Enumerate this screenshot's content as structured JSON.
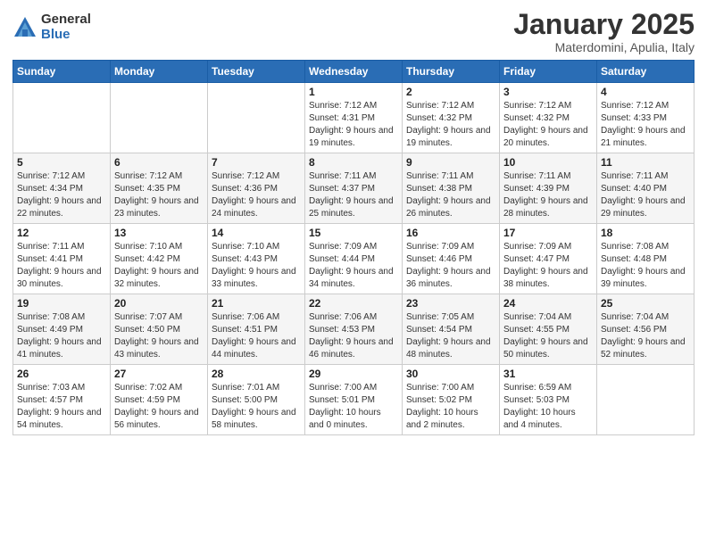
{
  "header": {
    "logo_general": "General",
    "logo_blue": "Blue",
    "month_title": "January 2025",
    "subtitle": "Materdomini, Apulia, Italy"
  },
  "days_of_week": [
    "Sunday",
    "Monday",
    "Tuesday",
    "Wednesday",
    "Thursday",
    "Friday",
    "Saturday"
  ],
  "weeks": [
    [
      {
        "day": "",
        "sunrise": "",
        "sunset": "",
        "daylight": ""
      },
      {
        "day": "",
        "sunrise": "",
        "sunset": "",
        "daylight": ""
      },
      {
        "day": "",
        "sunrise": "",
        "sunset": "",
        "daylight": ""
      },
      {
        "day": "1",
        "sunrise": "Sunrise: 7:12 AM",
        "sunset": "Sunset: 4:31 PM",
        "daylight": "Daylight: 9 hours and 19 minutes."
      },
      {
        "day": "2",
        "sunrise": "Sunrise: 7:12 AM",
        "sunset": "Sunset: 4:32 PM",
        "daylight": "Daylight: 9 hours and 19 minutes."
      },
      {
        "day": "3",
        "sunrise": "Sunrise: 7:12 AM",
        "sunset": "Sunset: 4:32 PM",
        "daylight": "Daylight: 9 hours and 20 minutes."
      },
      {
        "day": "4",
        "sunrise": "Sunrise: 7:12 AM",
        "sunset": "Sunset: 4:33 PM",
        "daylight": "Daylight: 9 hours and 21 minutes."
      }
    ],
    [
      {
        "day": "5",
        "sunrise": "Sunrise: 7:12 AM",
        "sunset": "Sunset: 4:34 PM",
        "daylight": "Daylight: 9 hours and 22 minutes."
      },
      {
        "day": "6",
        "sunrise": "Sunrise: 7:12 AM",
        "sunset": "Sunset: 4:35 PM",
        "daylight": "Daylight: 9 hours and 23 minutes."
      },
      {
        "day": "7",
        "sunrise": "Sunrise: 7:12 AM",
        "sunset": "Sunset: 4:36 PM",
        "daylight": "Daylight: 9 hours and 24 minutes."
      },
      {
        "day": "8",
        "sunrise": "Sunrise: 7:11 AM",
        "sunset": "Sunset: 4:37 PM",
        "daylight": "Daylight: 9 hours and 25 minutes."
      },
      {
        "day": "9",
        "sunrise": "Sunrise: 7:11 AM",
        "sunset": "Sunset: 4:38 PM",
        "daylight": "Daylight: 9 hours and 26 minutes."
      },
      {
        "day": "10",
        "sunrise": "Sunrise: 7:11 AM",
        "sunset": "Sunset: 4:39 PM",
        "daylight": "Daylight: 9 hours and 28 minutes."
      },
      {
        "day": "11",
        "sunrise": "Sunrise: 7:11 AM",
        "sunset": "Sunset: 4:40 PM",
        "daylight": "Daylight: 9 hours and 29 minutes."
      }
    ],
    [
      {
        "day": "12",
        "sunrise": "Sunrise: 7:11 AM",
        "sunset": "Sunset: 4:41 PM",
        "daylight": "Daylight: 9 hours and 30 minutes."
      },
      {
        "day": "13",
        "sunrise": "Sunrise: 7:10 AM",
        "sunset": "Sunset: 4:42 PM",
        "daylight": "Daylight: 9 hours and 32 minutes."
      },
      {
        "day": "14",
        "sunrise": "Sunrise: 7:10 AM",
        "sunset": "Sunset: 4:43 PM",
        "daylight": "Daylight: 9 hours and 33 minutes."
      },
      {
        "day": "15",
        "sunrise": "Sunrise: 7:09 AM",
        "sunset": "Sunset: 4:44 PM",
        "daylight": "Daylight: 9 hours and 34 minutes."
      },
      {
        "day": "16",
        "sunrise": "Sunrise: 7:09 AM",
        "sunset": "Sunset: 4:46 PM",
        "daylight": "Daylight: 9 hours and 36 minutes."
      },
      {
        "day": "17",
        "sunrise": "Sunrise: 7:09 AM",
        "sunset": "Sunset: 4:47 PM",
        "daylight": "Daylight: 9 hours and 38 minutes."
      },
      {
        "day": "18",
        "sunrise": "Sunrise: 7:08 AM",
        "sunset": "Sunset: 4:48 PM",
        "daylight": "Daylight: 9 hours and 39 minutes."
      }
    ],
    [
      {
        "day": "19",
        "sunrise": "Sunrise: 7:08 AM",
        "sunset": "Sunset: 4:49 PM",
        "daylight": "Daylight: 9 hours and 41 minutes."
      },
      {
        "day": "20",
        "sunrise": "Sunrise: 7:07 AM",
        "sunset": "Sunset: 4:50 PM",
        "daylight": "Daylight: 9 hours and 43 minutes."
      },
      {
        "day": "21",
        "sunrise": "Sunrise: 7:06 AM",
        "sunset": "Sunset: 4:51 PM",
        "daylight": "Daylight: 9 hours and 44 minutes."
      },
      {
        "day": "22",
        "sunrise": "Sunrise: 7:06 AM",
        "sunset": "Sunset: 4:53 PM",
        "daylight": "Daylight: 9 hours and 46 minutes."
      },
      {
        "day": "23",
        "sunrise": "Sunrise: 7:05 AM",
        "sunset": "Sunset: 4:54 PM",
        "daylight": "Daylight: 9 hours and 48 minutes."
      },
      {
        "day": "24",
        "sunrise": "Sunrise: 7:04 AM",
        "sunset": "Sunset: 4:55 PM",
        "daylight": "Daylight: 9 hours and 50 minutes."
      },
      {
        "day": "25",
        "sunrise": "Sunrise: 7:04 AM",
        "sunset": "Sunset: 4:56 PM",
        "daylight": "Daylight: 9 hours and 52 minutes."
      }
    ],
    [
      {
        "day": "26",
        "sunrise": "Sunrise: 7:03 AM",
        "sunset": "Sunset: 4:57 PM",
        "daylight": "Daylight: 9 hours and 54 minutes."
      },
      {
        "day": "27",
        "sunrise": "Sunrise: 7:02 AM",
        "sunset": "Sunset: 4:59 PM",
        "daylight": "Daylight: 9 hours and 56 minutes."
      },
      {
        "day": "28",
        "sunrise": "Sunrise: 7:01 AM",
        "sunset": "Sunset: 5:00 PM",
        "daylight": "Daylight: 9 hours and 58 minutes."
      },
      {
        "day": "29",
        "sunrise": "Sunrise: 7:00 AM",
        "sunset": "Sunset: 5:01 PM",
        "daylight": "Daylight: 10 hours and 0 minutes."
      },
      {
        "day": "30",
        "sunrise": "Sunrise: 7:00 AM",
        "sunset": "Sunset: 5:02 PM",
        "daylight": "Daylight: 10 hours and 2 minutes."
      },
      {
        "day": "31",
        "sunrise": "Sunrise: 6:59 AM",
        "sunset": "Sunset: 5:03 PM",
        "daylight": "Daylight: 10 hours and 4 minutes."
      },
      {
        "day": "",
        "sunrise": "",
        "sunset": "",
        "daylight": ""
      }
    ]
  ]
}
